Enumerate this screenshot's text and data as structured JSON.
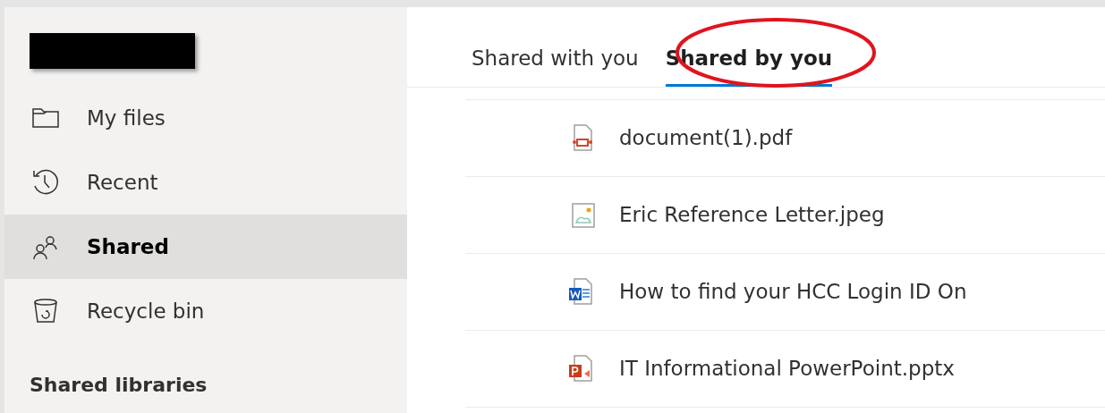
{
  "sidebar": {
    "items": [
      {
        "label": "My files",
        "kind": "folder",
        "selected": false
      },
      {
        "label": "Recent",
        "kind": "recent",
        "selected": false
      },
      {
        "label": "Shared",
        "kind": "shared",
        "selected": true
      },
      {
        "label": "Recycle bin",
        "kind": "recycle",
        "selected": false
      }
    ],
    "section_heading": "Shared libraries"
  },
  "tabs": [
    {
      "label": "Shared with you",
      "selected": false
    },
    {
      "label": "Shared by you",
      "selected": true
    }
  ],
  "files": [
    {
      "name": "document(1).pdf",
      "kind": "pdf"
    },
    {
      "name": "Eric Reference Letter.jpeg",
      "kind": "image"
    },
    {
      "name": "How to find your HCC Login ID On",
      "kind": "word"
    },
    {
      "name": "IT Informational PowerPoint.pptx",
      "kind": "powerpoint"
    }
  ]
}
